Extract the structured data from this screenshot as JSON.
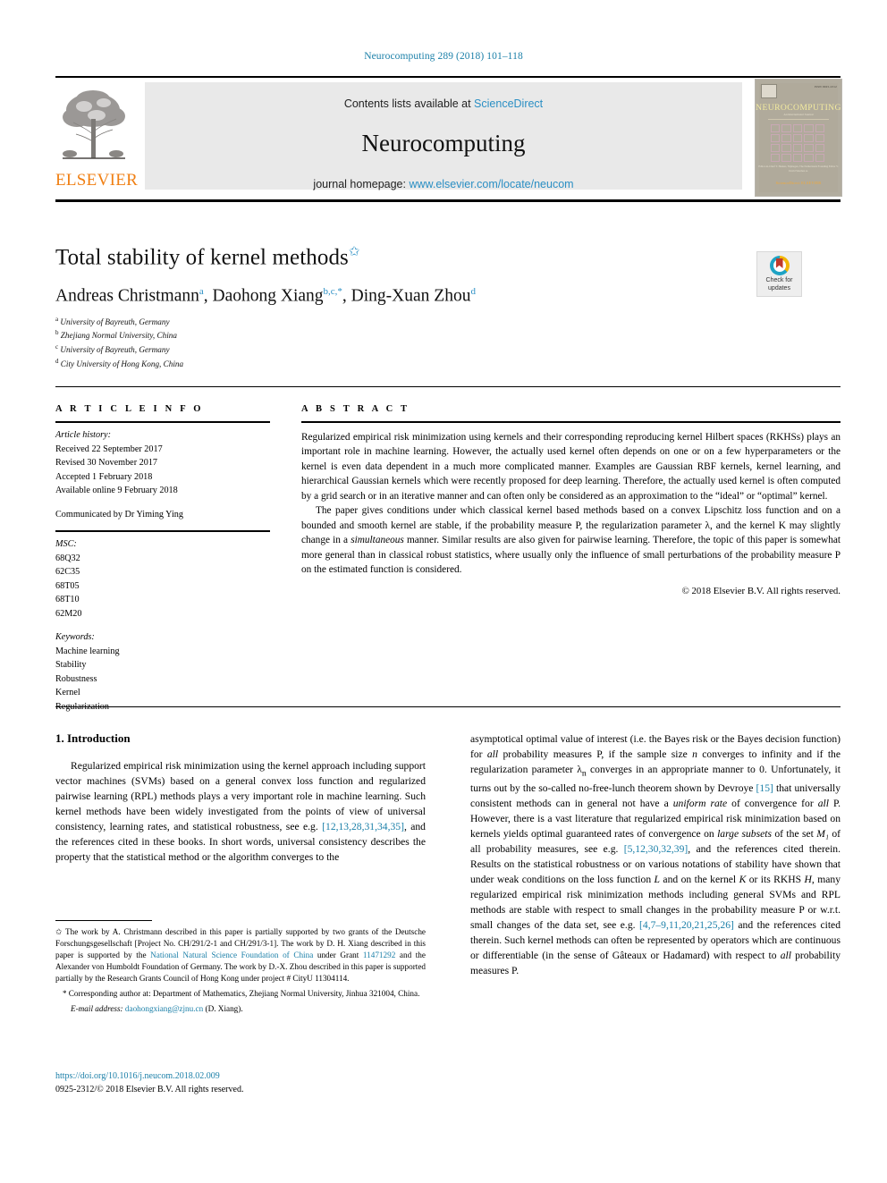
{
  "running_head": "Neurocomputing 289 (2018) 101–118",
  "masthead": {
    "contents_prefix": "Contents lists available at ",
    "sciencedirect": "ScienceDirect",
    "journal_name": "Neurocomputing",
    "homepage_prefix": "journal homepage: ",
    "homepage_url": "www.elsevier.com/locate/neucom",
    "publisher": "ELSEVIER",
    "cover": {
      "title": "NEUROCOMPUTING",
      "subtitle": "An International Journal",
      "issn": "ISSN 0925-2312",
      "editor_block": "Editor-in-Chief\nT. Heskes, Nijmegen, The Netherlands\nFounding Editor\nV. David Sánchez A.",
      "brand": "ScienceDirect\nELSEVIER"
    }
  },
  "article": {
    "title": "Total stability of kernel methods",
    "title_star": "✩",
    "authors_html": "Andreas Christmann, Daohong Xiang, Ding-Xuan Zhou",
    "author_list": [
      {
        "name": "Andreas Christmann",
        "marks": "a"
      },
      {
        "name": "Daohong Xiang",
        "marks": "b,c,*"
      },
      {
        "name": "Ding-Xuan Zhou",
        "marks": "d"
      }
    ],
    "affiliations": [
      {
        "mark": "a",
        "text": "University of Bayreuth, Germany"
      },
      {
        "mark": "b",
        "text": "Zhejiang Normal University, China"
      },
      {
        "mark": "c",
        "text": "University of Bayreuth, Germany"
      },
      {
        "mark": "d",
        "text": "City University of Hong Kong, China"
      }
    ],
    "crossmark_label": "Check for updates"
  },
  "info": {
    "heading": "A R T I C L E   I N F O",
    "history_label": "Article history:",
    "history": [
      "Received 22 September 2017",
      "Revised 30 November 2017",
      "Accepted 1 February 2018",
      "Available online 9 February 2018"
    ],
    "communicated": "Communicated by Dr Yiming Ying",
    "msc_label": "MSC:",
    "msc": [
      "68Q32",
      "62C35",
      "68T05",
      "68T10",
      "62M20"
    ],
    "keywords_label": "Keywords:",
    "keywords": [
      "Machine learning",
      "Stability",
      "Robustness",
      "Kernel",
      "Regularization"
    ]
  },
  "abstract": {
    "heading": "A B S T R A C T",
    "paragraph1": "Regularized empirical risk minimization using kernels and their corresponding reproducing kernel Hilbert spaces (RKHSs) plays an important role in machine learning. However, the actually used kernel often depends on one or on a few hyperparameters or the kernel is even data dependent in a much more complicated manner. Examples are Gaussian RBF kernels, kernel learning, and hierarchical Gaussian kernels which were recently proposed for deep learning. Therefore, the actually used kernel is often computed by a grid search or in an iterative manner and can often only be considered as an approximation to the “ideal” or “optimal” kernel.",
    "paragraph2_a": "The paper gives conditions under which classical kernel based methods based on a convex Lipschitz loss function and on a bounded and smooth kernel are stable, if the probability measure P, the regularization parameter λ, and the kernel K may slightly change in a ",
    "paragraph2_italic": "simultaneous",
    "paragraph2_b": " manner. Similar results are also given for pairwise learning. Therefore, the topic of this paper is somewhat more general than in classical robust statistics, where usually only the influence of small perturbations of the probability measure P on the estimated function is considered.",
    "copyright": "© 2018 Elsevier B.V. All rights reserved."
  },
  "body": {
    "section_heading": "1. Introduction",
    "left_p1_a": "Regularized empirical risk minimization using the kernel approach including support vector machines (SVMs) based on a general convex loss function and regularized pairwise learning (RPL) methods plays a very important role in machine learning. Such kernel methods have been widely investigated from the points of view of universal consistency, learning rates, and statistical robustness, see e.g. ",
    "left_ref1": "[12,13,28,31,34,35]",
    "left_p1_b": ", and the references cited in these books. In short words, universal consistency describes the property that the statistical method or the algorithm converges to the",
    "right_p1_a": "asymptotical optimal value of interest (i.e. the Bayes risk or the Bayes decision function) for ",
    "right_it1": "all",
    "right_p1_b": " probability measures P, if the sample size ",
    "right_it2": "n",
    "right_p1_c": " converges to infinity and if the regularization parameter λ",
    "right_sub_n": "n",
    "right_p1_d": " converges in an appropriate manner to 0. Unfortunately, it turns out by the so-called no-free-lunch theorem shown by Devroye ",
    "right_ref1": "[15]",
    "right_p1_e": " that universally consistent methods can in general not have a ",
    "right_it3": "uniform rate",
    "right_p1_f": " of convergence for ",
    "right_it4": "all",
    "right_p1_g": " P. However, there is a vast literature that regularized empirical risk minimization based on kernels yields optimal guaranteed rates of convergence on ",
    "right_it5": "large subsets",
    "right_p1_h": " of the set ",
    "right_m1": "M₁",
    "right_p1_i": " of all probability measures, see e.g. ",
    "right_ref2": "[5,12,30,32,39]",
    "right_p1_j": ", and the references cited therein. Results on the statistical robustness or on various notations of stability have shown that under weak conditions on the loss function ",
    "right_it6": "L",
    "right_p1_k": " and on the kernel ",
    "right_it7": "K",
    "right_p1_l": " or its RKHS ",
    "right_it8": "H",
    "right_p1_m": ", many regularized empirical risk minimization methods including general SVMs and RPL methods are stable with respect to small changes in the probability measure P or w.r.t. small changes of the data set, see e.g. ",
    "right_ref3": "[4,7–9,11,20,21,25,26]",
    "right_p1_n": " and the references cited therein. Such kernel methods can often be represented by operators which are continuous or differentiable (in the sense of Gâteaux or Hadamard) with respect to ",
    "right_it9": "all",
    "right_p1_o": " probability measures P."
  },
  "footnotes": {
    "star_mark": "✩",
    "fn1_a": " The work by A. Christmann described in this paper is partially supported by two grants of the Deutsche Forschungsgesellschaft [Project No. CH/291/2-1 and CH/291/3-1]. The work by D. H. Xiang described in this paper is supported by the ",
    "fn1_link1": "National Natural Science Foundation of China",
    "fn1_b": " under Grant ",
    "fn1_link2": "11471292",
    "fn1_c": " and the Alexander von Humboldt Foundation of Germany. The work by D.-X. Zhou described in this paper is supported partially by the Research Grants Council of Hong Kong under project # CityU 11304114.",
    "fn2_mark": "*",
    "fn2": " Corresponding author at: Department of Mathematics, Zhejiang Normal University, Jinhua 321004, China.",
    "fn3_label": "E-mail address:",
    "fn3_email": "daohongxiang@zjnu.cn",
    "fn3_tail": " (D. Xiang)."
  },
  "imprint": {
    "doi": "https://doi.org/10.1016/j.neucom.2018.02.009",
    "issn_line": "0925-2312/© 2018 Elsevier B.V. All rights reserved."
  },
  "colors": {
    "link": "#1a7fa8",
    "sciencedirect": "#2b8fc4",
    "elsevier_orange": "#f07f13",
    "panel_grey": "#e9e9e9"
  }
}
